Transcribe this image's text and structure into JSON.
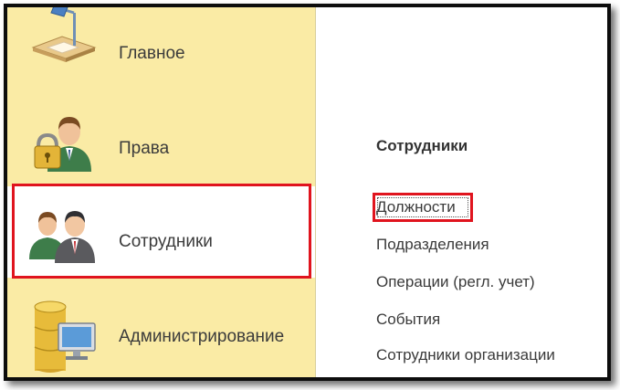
{
  "sidebar": {
    "items": [
      {
        "label": "Главное",
        "icon": "desk-lamp-icon"
      },
      {
        "label": "Права",
        "icon": "user-lock-icon"
      },
      {
        "label": "Сотрудники",
        "icon": "employees-icon"
      },
      {
        "label": "Администрирование",
        "icon": "database-monitor-icon"
      }
    ],
    "selected": "Сотрудники"
  },
  "content": {
    "section_title": "Сотрудники",
    "links": [
      "Должности",
      "Подразделения",
      "Операции (регл. учет)",
      "События",
      "Сотрудники организации"
    ]
  },
  "colors": {
    "sidebar_bg": "#faeba5",
    "highlight": "#e0141e",
    "text": "#3b3b3b"
  }
}
